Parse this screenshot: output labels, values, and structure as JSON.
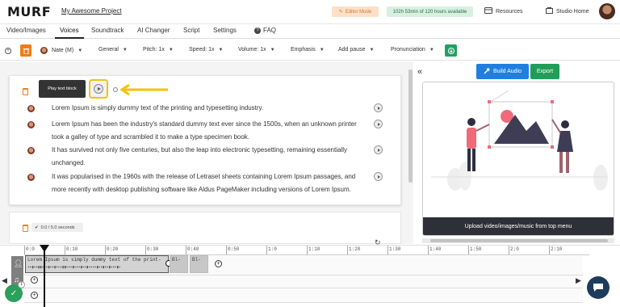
{
  "header": {
    "logo": "MURF",
    "project_name": "My Awesome Project",
    "editor_mode_label": "Editor Mode",
    "time_available": "102h 53min of 120 hours available",
    "resources_label": "Resources",
    "studio_home_label": "Studio Home"
  },
  "tabs": [
    {
      "label": "Video/Images"
    },
    {
      "label": "Voices"
    },
    {
      "label": "Soundtrack"
    },
    {
      "label": "AI Changer"
    },
    {
      "label": "Script"
    },
    {
      "label": "Settings"
    },
    {
      "label": "FAQ"
    }
  ],
  "toolbar": {
    "voice": "Nate (M)",
    "style": "General",
    "pitch": "Pitch: 1x",
    "speed": "Speed: 1x",
    "volume": "Volume: 1x",
    "emphasis": "Emphasis",
    "add_pause": "Add pause",
    "pronunciation": "Pronunciation"
  },
  "block": {
    "tooltip": "Play text block",
    "lines": [
      "Lorem Ipsum is simply dummy text of the printing and typesetting industry.",
      "Lorem Ipsum has been the industry's standard dummy text ever since the 1500s, when an unknown printer took a galley of type and scrambled it to make a type specimen book.",
      "It has survived not only five centuries, but also the leap into electronic typesetting, remaining essentially unchanged.",
      "It was popularised in the 1960s with the release of Letraset sheets containing Lorem Ipsum passages, and more recently with desktop publishing software like Aldus PageMaker including versions of Lorem Ipsum."
    ]
  },
  "block2": {
    "duration": "0.0 / 5.0 seconds"
  },
  "right_panel": {
    "build_audio": "Build Audio",
    "export": "Export",
    "upload_hint": "Upload video/images/music from top menu"
  },
  "timeline": {
    "ticks": [
      "0:0",
      "0:10",
      "0:20",
      "0:30",
      "0:40",
      "0:50",
      "1:0",
      "1:10",
      "1:20",
      "1:30",
      "1:40",
      "1:50",
      "2:0",
      "2:10"
    ],
    "clip_text": "Lorem Ipsum is simply dummy text of the print-",
    "clip_small_1": "Bl-",
    "clip_small_2": "Bl-",
    "badge_count": "1"
  },
  "colors": {
    "accent_orange": "#f07d1a",
    "accent_green": "#22a061",
    "accent_blue": "#1f7fe0",
    "highlight_yellow": "#f3c20c"
  },
  "icons": {
    "editor_mode": "pencil-icon",
    "resources": "resources-icon",
    "studio_home": "home-icon",
    "faq": "question-icon"
  }
}
